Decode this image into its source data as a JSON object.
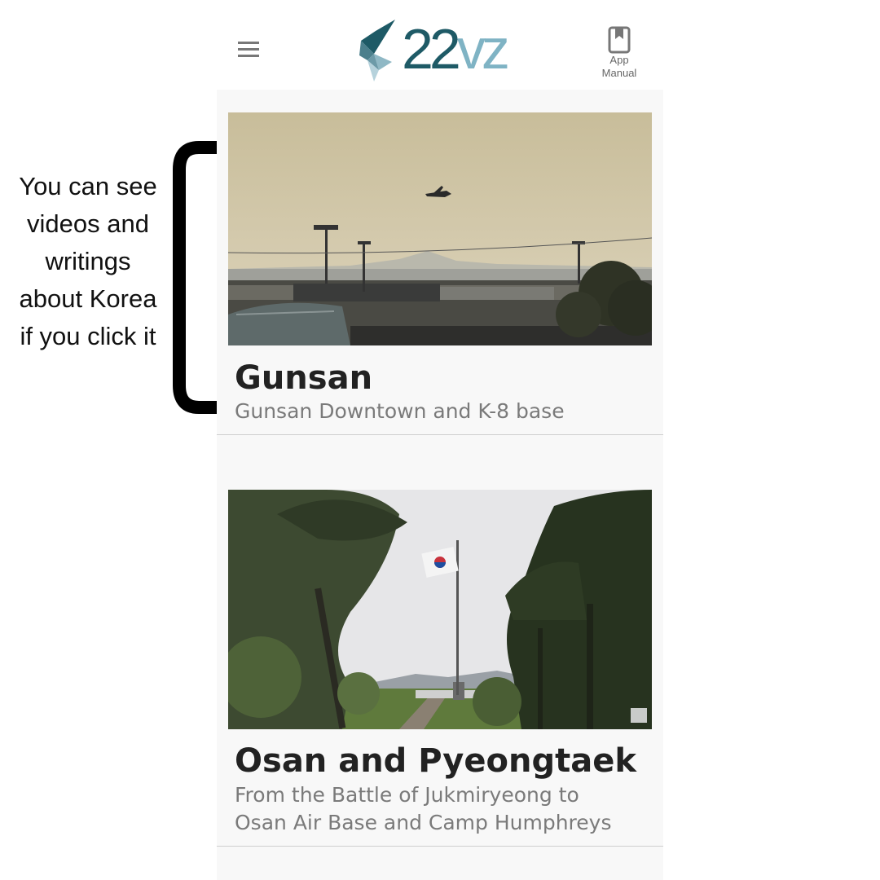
{
  "header": {
    "logo_digits": "22",
    "logo_letters": "vz",
    "manual_label_line1": "App",
    "manual_label_line2": "Manual",
    "menu_icon": "hamburger-menu-icon",
    "manual_icon": "bookmark-book-icon"
  },
  "annotation": {
    "lines": [
      "You can see",
      "videos and",
      "writings",
      "about Korea",
      "if you click it"
    ]
  },
  "cards": [
    {
      "title": "Gunsan",
      "subtitle": "Gunsan Downtown and K-8 base"
    },
    {
      "title": "Osan and Pyeongtaek",
      "subtitle_line1": "From the Battle of Jukmiryeong to",
      "subtitle_line2": "Osan Air Base and Camp Humphreys"
    }
  ],
  "colors": {
    "logo_dark": "#1e5a66",
    "logo_light": "#7fb3c4",
    "annotation_bracket": "#000000"
  }
}
